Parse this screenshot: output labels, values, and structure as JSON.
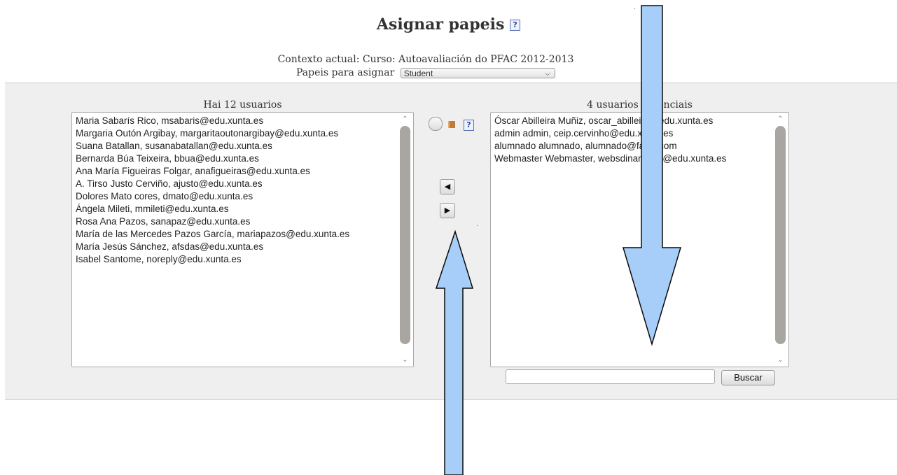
{
  "page": {
    "title": "Asignar papeis",
    "help_glyph": "?"
  },
  "context": {
    "text": "Contexto actual: Curso: Autoavaliación do PFAC 2012-2013"
  },
  "role": {
    "label": "Papeis para asignar",
    "selected": "Student"
  },
  "left_list": {
    "label": "Hai 12 usuarios",
    "items": [
      "Maria Sabarís Rico, msabaris@edu.xunta.es",
      "Margaria Outón Argibay, margaritaoutonargibay@edu.xunta.es",
      "Suana Batallan, susanabatallan@edu.xunta.es",
      "Bernarda Búa Teixeira, bbua@edu.xunta.es",
      "Ana María Figueiras Folgar, anafigueiras@edu.xunta.es",
      "A. Tirso Justo Cerviño, ajusto@edu.xunta.es",
      "Dolores Mato cores, dmato@edu.xunta.es",
      "Ángela Mileti, mmileti@edu.xunta.es",
      "Rosa Ana Pazos, sanapaz@edu.xunta.es",
      "María de las Mercedes Pazos García, mariapazos@edu.xunta.es",
      "María Jesús Sánchez, afsdas@edu.xunta.es",
      "Isabel Santome, noreply@edu.xunta.es"
    ]
  },
  "right_list": {
    "label": "4 usuarios potenciais",
    "items": [
      "Óscar Abilleira Muñiz, oscar_abilleira@edu.xunta.es",
      "admin admin, ceip.cervinho@edu.xunta.es",
      "alumnado alumnado, alumnado@falso.com",
      "Webmaster Webmaster, websdinamicas@edu.xunta.es"
    ]
  },
  "controls": {
    "add_arrow": "◀",
    "remove_arrow": "▶",
    "help_glyph": "?"
  },
  "search": {
    "value": "",
    "button_label": "Buscar"
  },
  "colors": {
    "panel_bg": "#efefef",
    "annotation_arrow": "#a6cef9",
    "annotation_stroke": "#0a0a0a"
  }
}
